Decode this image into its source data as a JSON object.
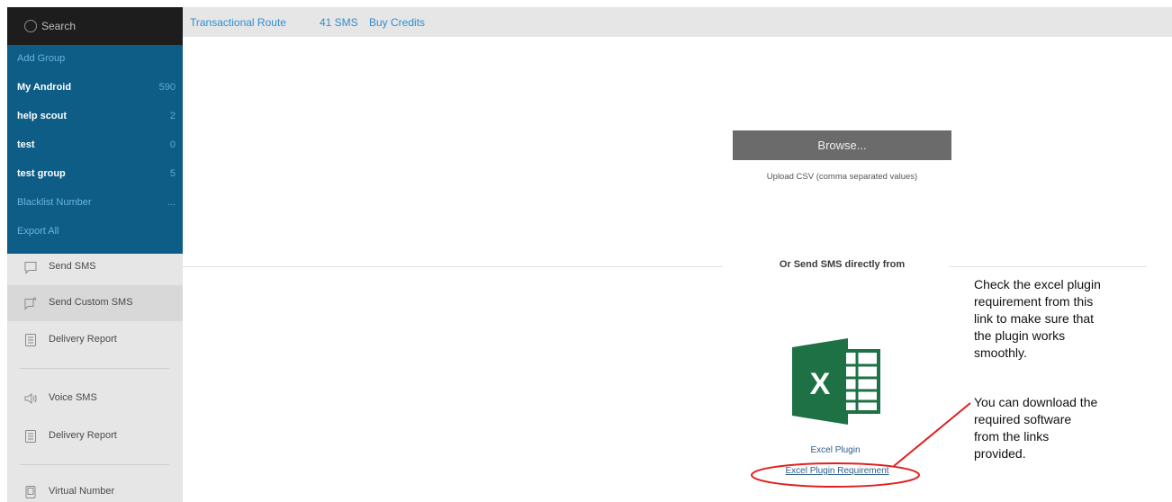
{
  "search": {
    "placeholder": "Search"
  },
  "groups": {
    "add_group": "Add Group",
    "items": [
      {
        "label": "My Android",
        "count": "590"
      },
      {
        "label": "help scout",
        "count": "2"
      },
      {
        "label": "test",
        "count": "0"
      },
      {
        "label": "test group",
        "count": "5"
      }
    ],
    "blacklist": {
      "label": "Blacklist Number",
      "count": "..."
    },
    "export_all": "Export All"
  },
  "nav": {
    "send_sms": "Send SMS",
    "send_custom_sms": "Send Custom SMS",
    "delivery_report_1": "Delivery Report",
    "voice_sms": "Voice SMS",
    "delivery_report_2": "Delivery Report",
    "virtual_number": "Virtual Number"
  },
  "topbar": {
    "route": "Transactional Route",
    "sms_count": "41 SMS",
    "buy_credits": "Buy Credits"
  },
  "upload": {
    "browse_label": "Browse...",
    "caption": "Upload CSV (comma separated values)"
  },
  "direct": {
    "heading": "Or Send SMS directly from",
    "excel_plugin": "Excel Plugin",
    "excel_plugin_requirement": "Excel Plugin Requirement"
  },
  "annotation": {
    "line1": "Check the excel plugin",
    "line2": "requirement from this",
    "line3": "link to make sure that",
    "line4": "the plugin works",
    "line5": "smoothly.",
    "line6": "You can download the",
    "line7": "required software",
    "line8": "from the links",
    "line9": "provided."
  },
  "colors": {
    "sidebar_blue": "#0e5d86",
    "link_blue": "#2d8fd0",
    "excel_green": "#1e7145",
    "annotation_red": "#e02020"
  }
}
